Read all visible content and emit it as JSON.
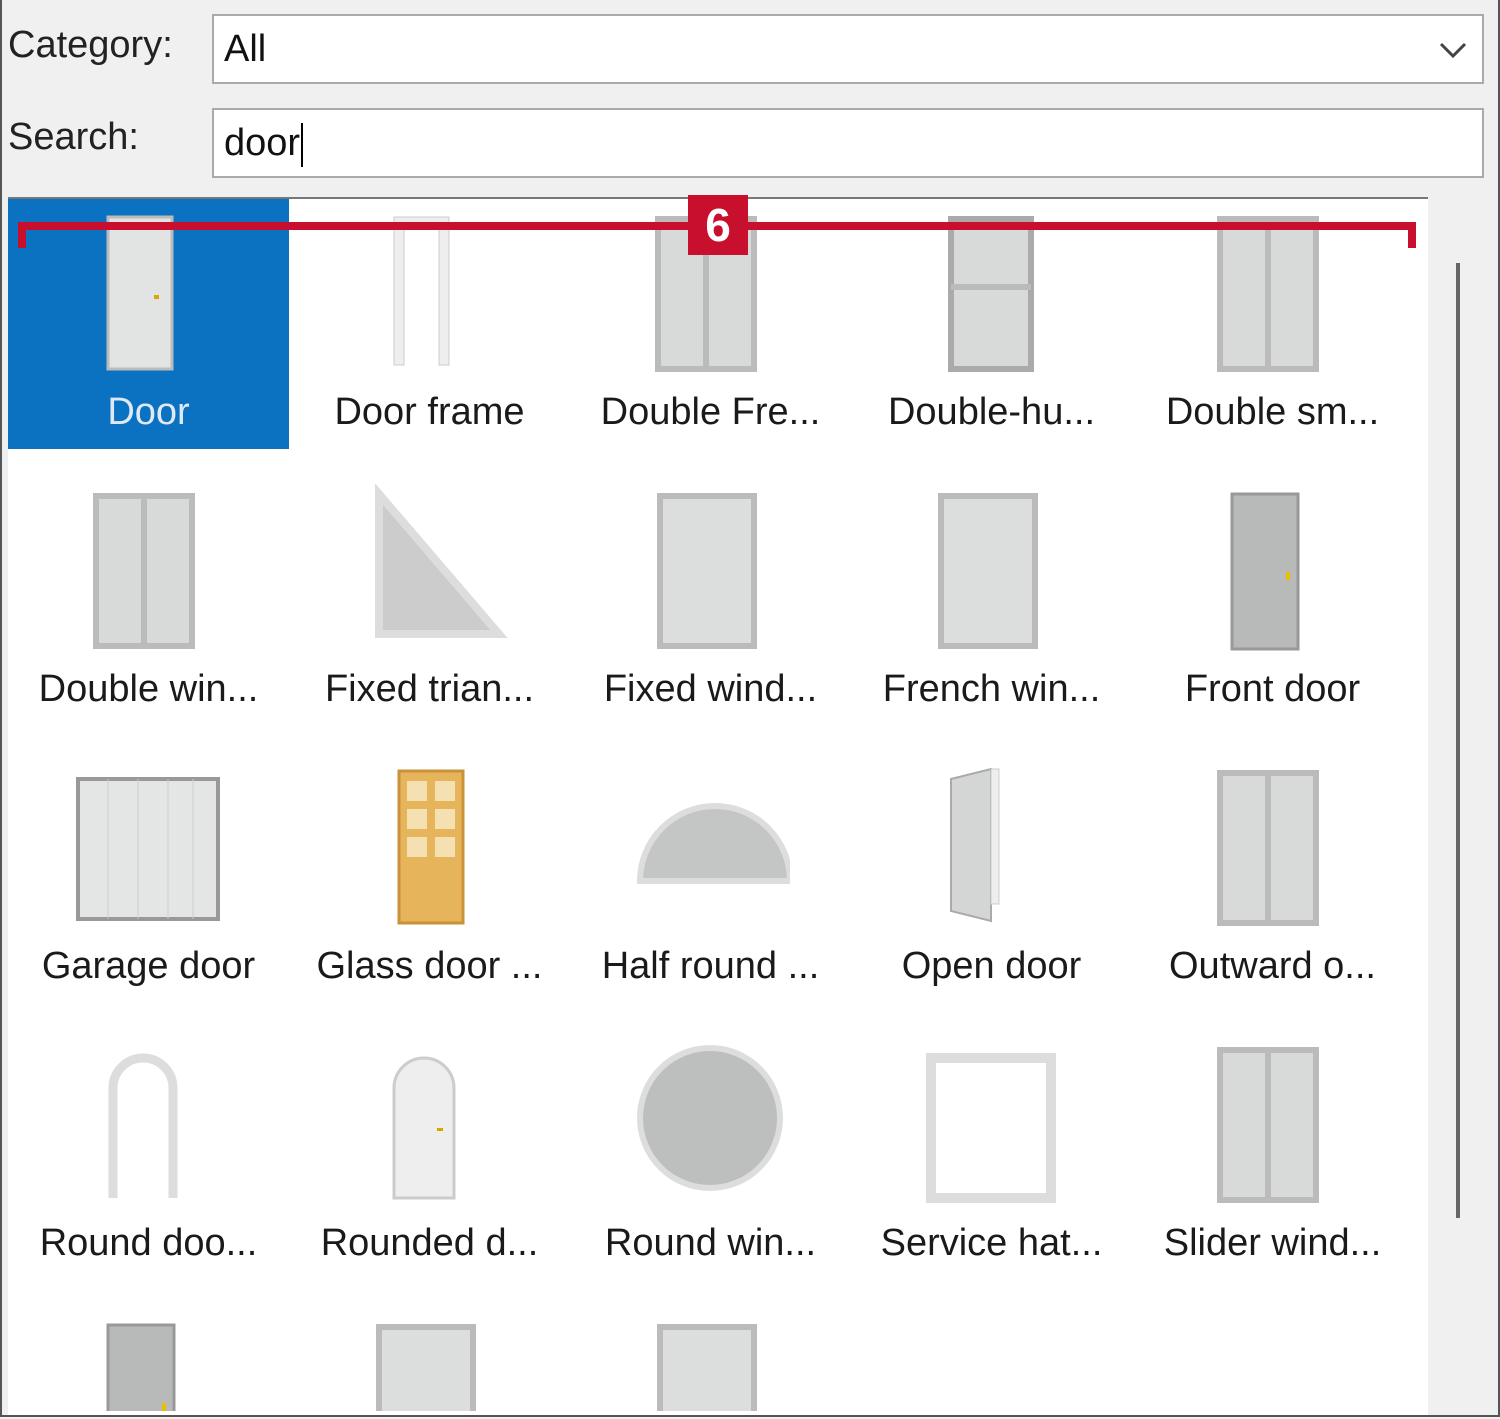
{
  "filters": {
    "category_label": "Category:",
    "category_value": "All",
    "search_label": "Search:",
    "search_value": "door"
  },
  "annotation": {
    "badge": "6",
    "color": "#c8102e"
  },
  "selection_color": "#0a72c0",
  "items": [
    {
      "name": "Door",
      "icon": "door",
      "selected": true
    },
    {
      "name": "Door frame",
      "icon": "frame"
    },
    {
      "name": "Double Fre...",
      "icon": "double-window"
    },
    {
      "name": "Double-hu...",
      "icon": "double-hung"
    },
    {
      "name": "Double sm...",
      "icon": "double-window"
    },
    {
      "name": "Double win...",
      "icon": "double-window"
    },
    {
      "name": "Fixed trian...",
      "icon": "triangle"
    },
    {
      "name": "Fixed wind...",
      "icon": "window"
    },
    {
      "name": "French win...",
      "icon": "window"
    },
    {
      "name": "Front door",
      "icon": "dark-door"
    },
    {
      "name": "Garage door",
      "icon": "garage"
    },
    {
      "name": "Glass door ...",
      "icon": "glass-door"
    },
    {
      "name": "Half round ...",
      "icon": "half-round"
    },
    {
      "name": "Open door",
      "icon": "open-door"
    },
    {
      "name": "Outward o...",
      "icon": "double-window"
    },
    {
      "name": "Round doo...",
      "icon": "arch-frame"
    },
    {
      "name": "Rounded d...",
      "icon": "arch-door"
    },
    {
      "name": "Round win...",
      "icon": "circle"
    },
    {
      "name": "Service hat...",
      "icon": "frame-wide"
    },
    {
      "name": "Slider wind...",
      "icon": "double-window"
    },
    {
      "name": "",
      "icon": "dark-door"
    },
    {
      "name": "",
      "icon": "window"
    },
    {
      "name": "",
      "icon": "window"
    }
  ]
}
